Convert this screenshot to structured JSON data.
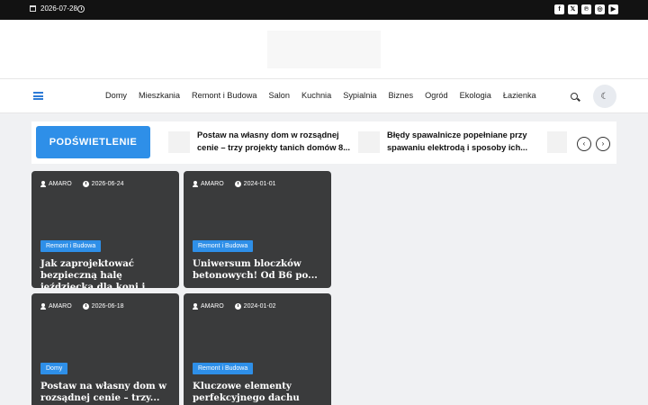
{
  "topbar": {
    "date": "2026-07-28",
    "socials": [
      {
        "icon": "facebook-icon",
        "glyph": "f"
      },
      {
        "icon": "x-icon",
        "glyph": "𝕏"
      },
      {
        "icon": "pinterest-icon",
        "glyph": "℗"
      },
      {
        "icon": "instagram-icon",
        "glyph": "◎"
      },
      {
        "icon": "youtube-icon",
        "glyph": "▶"
      }
    ]
  },
  "nav": {
    "items": [
      "Domy",
      "Mieszkania",
      "Remont i Budowa",
      "Salon",
      "Kuchnia",
      "Sypialnia",
      "Biznes",
      "Ogród",
      "Ekologia",
      "Łazienka"
    ]
  },
  "highlight": {
    "label": "PODŚWIETLENIE",
    "items": [
      {
        "title": "Postaw na własny dom w rozsądnej cenie – trzy projekty tanich domów 8..."
      },
      {
        "title": "Błędy spawalnicze popełniane przy spawaniu elektrodą i sposoby ich..."
      }
    ]
  },
  "cards": [
    {
      "author": "AMARO",
      "date": "2026-06-24",
      "category": "Remont i Budowa",
      "title": "Jak zaprojektować bezpieczną halę jeździecką dla koni i..."
    },
    {
      "author": "AMARO",
      "date": "2024-01-01",
      "category": "Remont i Budowa",
      "title": "Uniwersum bloczków betonowych! Od B6 po..."
    },
    {
      "author": "AMARO",
      "date": "2026-06-18",
      "category": "Domy",
      "title": "Postaw na własny dom w rozsądnej cenie – trzy..."
    },
    {
      "author": "AMARO",
      "date": "2024-01-02",
      "category": "Remont i Budowa",
      "title": "Kluczowe elementy perfekcyjnego dachu"
    }
  ],
  "colors": {
    "accent": "#2e8fe8",
    "topbar": "#121212",
    "card": "#3a3b3c"
  }
}
